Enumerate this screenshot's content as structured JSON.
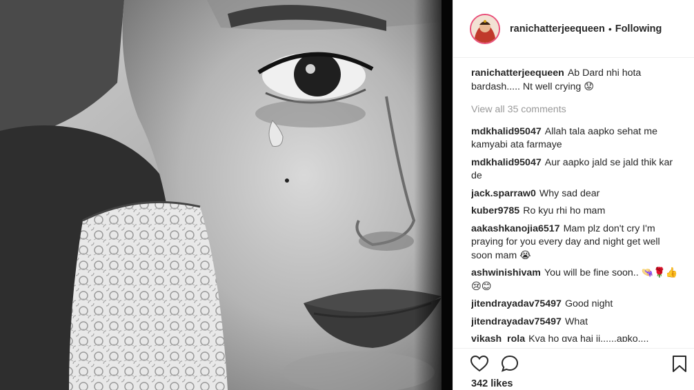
{
  "post": {
    "username": "ranichatterjeequeen",
    "separator": "•",
    "follow_status": "Following",
    "caption": {
      "username": "ranichatterjeequeen",
      "text": "Ab Dard nhi hota bardash..... Nt well crying 😟"
    },
    "view_all_comments": "View all 35 comments",
    "comments": [
      {
        "username": "mdkhalid95047",
        "text": "Allah tala aapko sehat me kamyabi ata farmaye"
      },
      {
        "username": "mdkhalid95047",
        "text": "Aur aapko jald se jald thik kar de"
      },
      {
        "username": "jack.sparraw0",
        "text": "Why sad dear"
      },
      {
        "username": "kuber9785",
        "text": "Ro kyu rhi ho mam"
      },
      {
        "username": "aakashkanojia6517",
        "text": "Mam plz don't cry I'm praying for you every day and night get well soon mam 😭"
      },
      {
        "username": "ashwinishivam",
        "text": "You will be fine soon.. 👒🌹👍😢😊"
      },
      {
        "username": "jitendrayadav75497",
        "text": "Good night"
      },
      {
        "username": "jitendrayadav75497",
        "text": "What"
      },
      {
        "username": "vikash_rola",
        "text": "Kya ho gya hai ji......apko...."
      }
    ],
    "likes": "342 likes",
    "icons": {
      "like": "heart-icon",
      "comment": "comment-bubble-icon",
      "save": "bookmark-icon"
    }
  }
}
